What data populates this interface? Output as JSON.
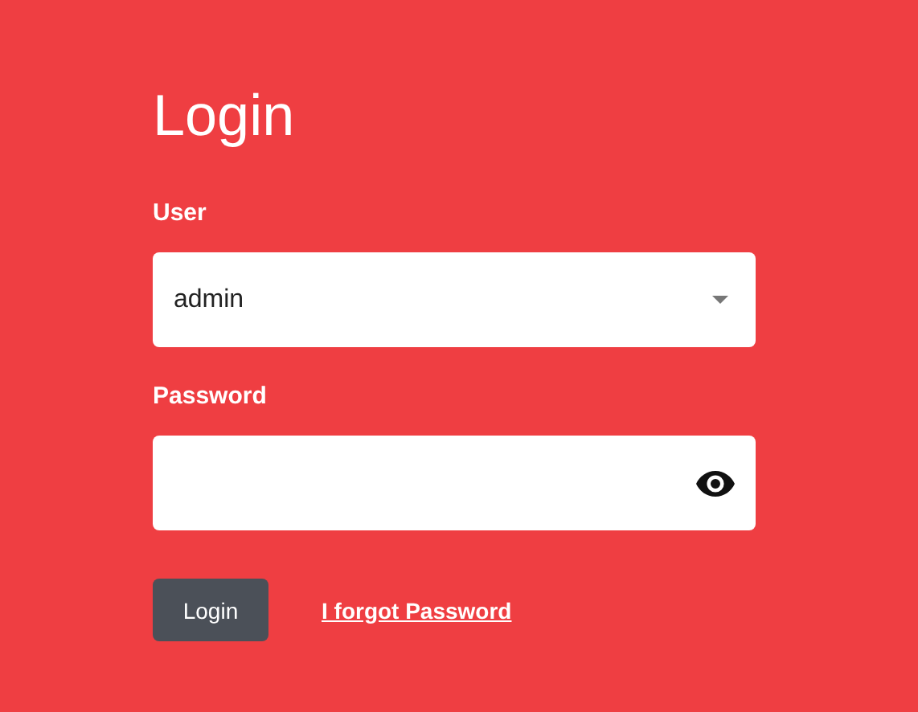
{
  "title": "Login",
  "fields": [
    {
      "label": "User",
      "value": "admin",
      "kind": "dropdown"
    },
    {
      "label": "Password",
      "kind": "password"
    }
  ],
  "login_button": "Login",
  "forgot_link": "I forgot Password"
}
